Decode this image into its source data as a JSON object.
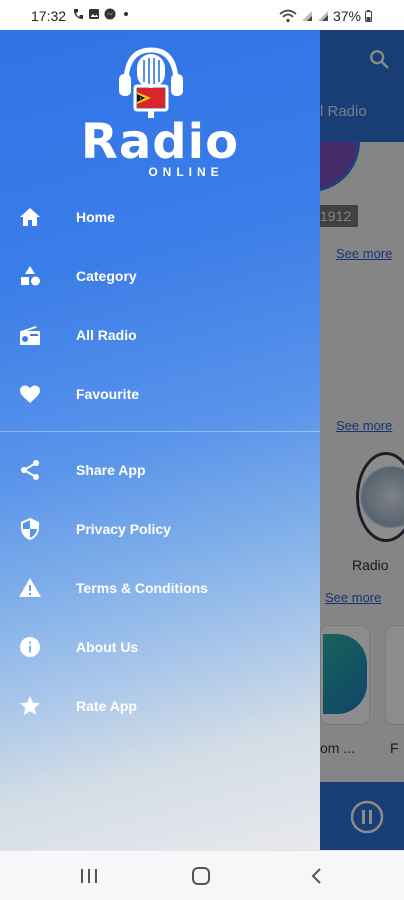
{
  "status_bar": {
    "time": "17:32",
    "battery": "37%",
    "icons": [
      "call-forward-icon",
      "gallery-icon",
      "messenger-icon",
      "dot-icon",
      "wifi-icon",
      "signal-icon",
      "signal-icon",
      "battery-icon"
    ]
  },
  "background_app": {
    "tab_label": "l Radio",
    "chip": "1912",
    "see_more": "See more",
    "radio_label": "Radio",
    "card_caption_1": "om ...",
    "card_caption_2": "F",
    "accent_color": "#2f6fd6"
  },
  "drawer": {
    "logo_title": "Radio",
    "logo_subtitle": "ONLINE",
    "primary_items": [
      {
        "label": "Home",
        "icon": "home-icon"
      },
      {
        "label": "Category",
        "icon": "category-icon"
      },
      {
        "label": "All Radio",
        "icon": "radio-icon"
      },
      {
        "label": "Favourite",
        "icon": "heart-icon"
      }
    ],
    "secondary_items": [
      {
        "label": "Share App",
        "icon": "share-icon"
      },
      {
        "label": "Privacy Policy",
        "icon": "shield-icon"
      },
      {
        "label": "Terms & Conditions",
        "icon": "warning-icon"
      },
      {
        "label": "About Us",
        "icon": "info-icon"
      },
      {
        "label": "Rate App",
        "icon": "star-icon"
      }
    ],
    "gradient_top": "#2f73e6",
    "gradient_bottom": "#e8e8ec"
  },
  "nav_bar": {
    "buttons": [
      "recent-apps-icon",
      "home-button-icon",
      "back-icon"
    ]
  }
}
